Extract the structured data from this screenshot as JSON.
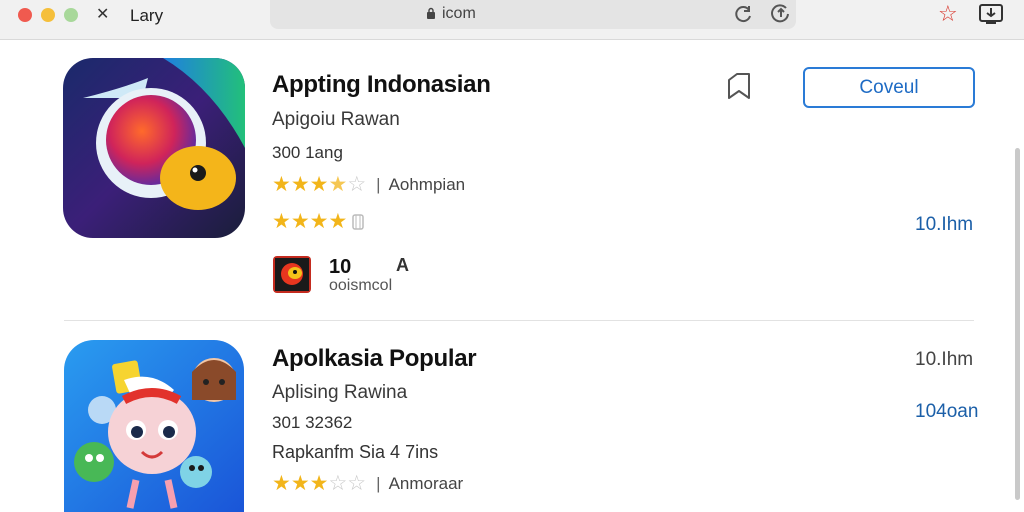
{
  "browser": {
    "tab_title": "Lary",
    "url": "icom"
  },
  "apps": [
    {
      "title": "Appting Indonasian",
      "subtitle": "Apigoiu Rawan",
      "size": "300 1ang",
      "rating": 3.5,
      "rating_label": "Aohmpian",
      "rating2": 4,
      "side_value": "10.Ihm",
      "button_label": "Coveul",
      "mini_count": "10",
      "mini_letter": "A",
      "mini_caption": "ooismcol"
    },
    {
      "title": "Apolkasia Popular",
      "subtitle": "Aplising Rawina",
      "size": "301 32362",
      "extra": "Rapkanfm Sia 4 7ins",
      "rating": 3,
      "rating_label": "Anmoraar",
      "side_value_top": "10.Ihm",
      "side_value": "104oan"
    }
  ],
  "colors": {
    "accent": "#2a7bd6",
    "star": "#f2b51a",
    "close": "#f05a4f",
    "minimize": "#f5bf3b",
    "zoom": "#a8d89a"
  },
  "icons": [
    "close-window-dot",
    "minimize-window-dot",
    "zoom-window-dot",
    "tab-icon",
    "lock-icon",
    "reload-icon",
    "share-tab-icon",
    "star-icon",
    "download-icon",
    "bookmark-icon"
  ]
}
